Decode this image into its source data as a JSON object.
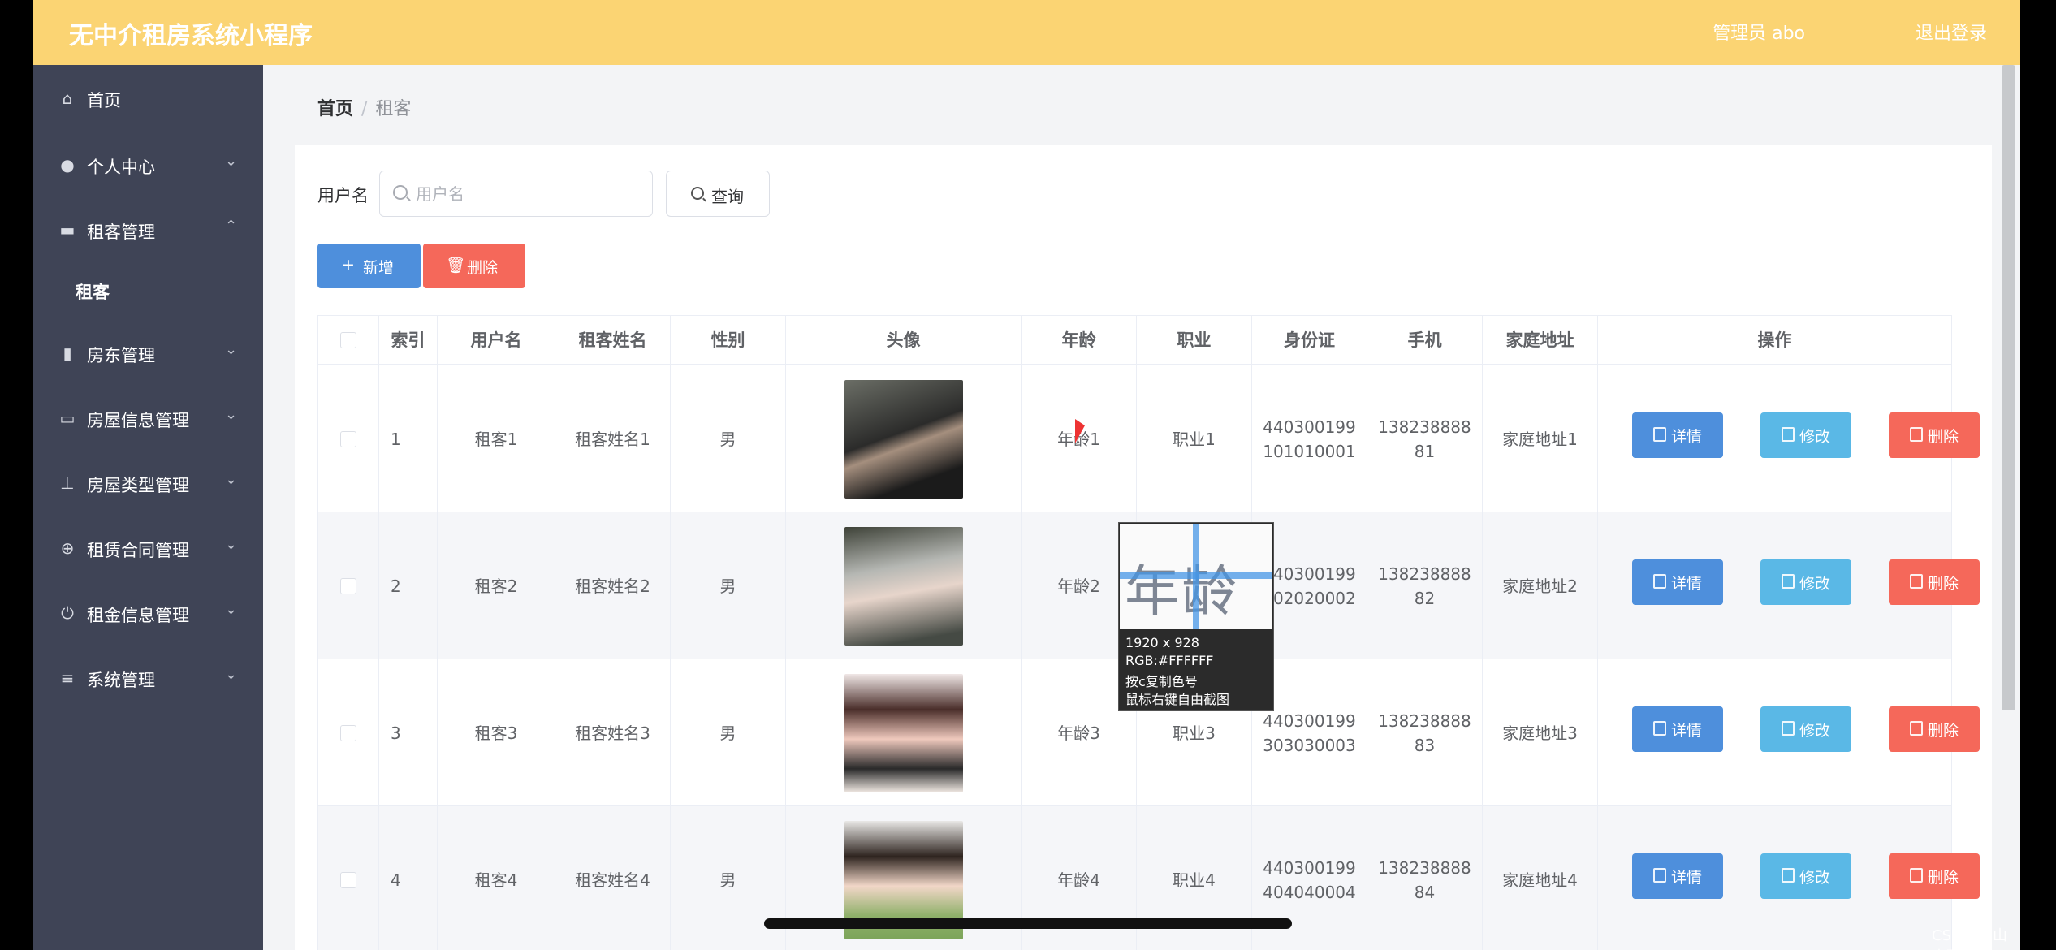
{
  "header": {
    "title": "无中介租房系统小程序",
    "admin": "管理员 abo",
    "logout": "退出登录"
  },
  "sidebar": {
    "items": [
      {
        "label": "首页",
        "icon": "home-icon"
      },
      {
        "label": "个人中心",
        "icon": "user-icon"
      },
      {
        "label": "租客管理",
        "icon": "monitor-icon"
      },
      {
        "label": "房东管理",
        "icon": "clipboard-icon"
      },
      {
        "label": "房屋信息管理",
        "icon": "card-icon"
      },
      {
        "label": "房屋类型管理",
        "icon": "stamp-icon"
      },
      {
        "label": "租赁合同管理",
        "icon": "compass-icon"
      },
      {
        "label": "租金信息管理",
        "icon": "power-icon"
      },
      {
        "label": "系统管理",
        "icon": "menu-icon"
      }
    ],
    "active_sub": "租客"
  },
  "breadcrumb": {
    "home": "首页",
    "sep": "/",
    "current": "租客"
  },
  "search": {
    "label": "用户名",
    "placeholder": "用户名",
    "value": "",
    "query_button": "查询"
  },
  "toolbar": {
    "add": "新增",
    "delete": "删除"
  },
  "table": {
    "headers": [
      "索引",
      "用户名",
      "租客姓名",
      "性别",
      "头像",
      "年龄",
      "职业",
      "身份证",
      "手机",
      "家庭地址",
      "操作"
    ],
    "rows": [
      {
        "index": "1",
        "username": "租客1",
        "name": "租客姓名1",
        "gender": "男",
        "age": "年龄1",
        "job": "职业1",
        "id_a": "440300199",
        "id_b": "101010001",
        "phone_a": "138238888",
        "phone_b": "81",
        "address": "家庭地址1"
      },
      {
        "index": "2",
        "username": "租客2",
        "name": "租客姓名2",
        "gender": "男",
        "age": "年龄2",
        "job": "",
        "id_a": "440300199",
        "id_b": "202020002",
        "phone_a": "138238888",
        "phone_b": "82",
        "address": "家庭地址2"
      },
      {
        "index": "3",
        "username": "租客3",
        "name": "租客姓名3",
        "gender": "男",
        "age": "年龄3",
        "job": "职业3",
        "id_a": "440300199",
        "id_b": "303030003",
        "phone_a": "138238888",
        "phone_b": "83",
        "address": "家庭地址3"
      },
      {
        "index": "4",
        "username": "租客4",
        "name": "租客姓名4",
        "gender": "男",
        "age": "年龄4",
        "job": "职业4",
        "id_a": "440300199",
        "id_b": "404040004",
        "phone_a": "138238888",
        "phone_b": "84",
        "address": "家庭地址4"
      }
    ],
    "actions": {
      "detail": "详情",
      "edit": "修改",
      "delete": "删除"
    }
  },
  "picker": {
    "zoom_text": "年龄",
    "size": "1920 x 928",
    "rgb": "RGB:#FFFFFF",
    "hint1": "按c复制色号",
    "hint2": "鼠标右键自由截图"
  },
  "watermark": "CSDN @山山而川粤",
  "colors": {
    "header": "#fbd473",
    "sidebar": "#3f4456",
    "primary": "#4e8fdc",
    "info": "#5ab8e6",
    "danger": "#f5685a"
  }
}
